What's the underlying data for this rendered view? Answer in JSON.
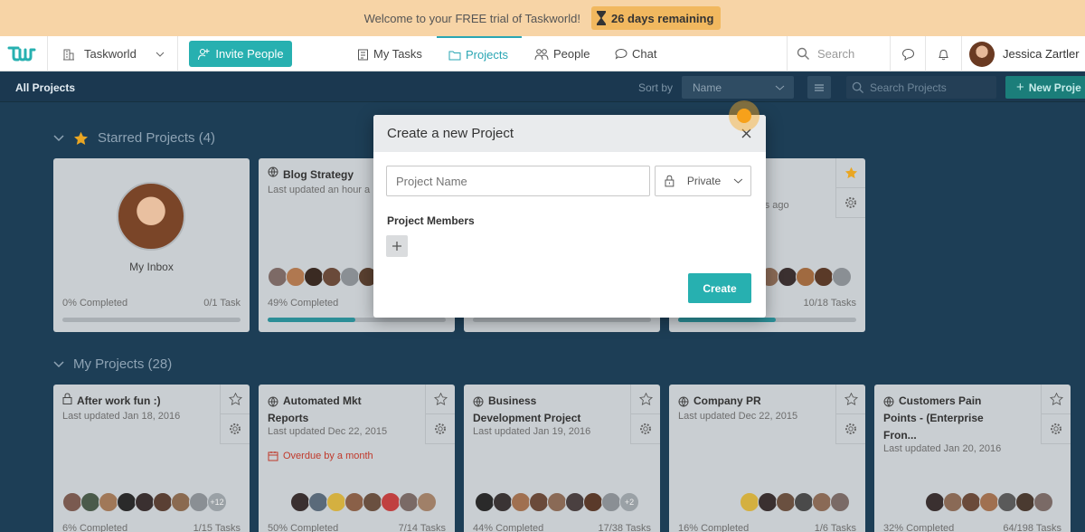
{
  "banner": {
    "message": "Welcome to your FREE trial of Taskworld!",
    "days_remaining": "26 days remaining"
  },
  "topnav": {
    "workspace": "Taskworld",
    "invite_label": "Invite People",
    "items": [
      {
        "label": "My Tasks",
        "icon": "clipboard-icon"
      },
      {
        "label": "Projects",
        "icon": "folder-icon",
        "active": true
      },
      {
        "label": "People",
        "icon": "people-icon"
      },
      {
        "label": "Chat",
        "icon": "chat-icon"
      }
    ],
    "search_placeholder": "Search",
    "user_name": "Jessica Zartler"
  },
  "subbar": {
    "title": "All Projects",
    "sort_label": "Sort by",
    "sort_value": "Name",
    "search_placeholder": "Search Projects",
    "new_project_label": "New Proje"
  },
  "starred": {
    "title": "Starred Projects (4)",
    "inbox": {
      "name": "My Inbox",
      "completed": "0% Completed",
      "tasks": "0/1 Task",
      "progress": 0
    },
    "blog": {
      "title": "Blog Strategy",
      "updated": "Last updated an hour a",
      "completed": "49% Completed",
      "progress": 49
    },
    "fourth": {
      "updated": "rs ago",
      "tasks": "10/18 Tasks",
      "progress": 55
    }
  },
  "my_projects": {
    "title": "My Projects (28)",
    "cards": [
      {
        "title_lines": [
          "After work fun :)"
        ],
        "updated": "Last updated Jan 18, 2016",
        "completed": "6% Completed",
        "tasks": "1/15 Tasks",
        "more": "+12",
        "privacy": "lock"
      },
      {
        "title_lines": [
          "Automated Mkt",
          "Reports"
        ],
        "updated": "Last updated Dec 22, 2015",
        "overdue": "Overdue by a month",
        "completed": "50% Completed",
        "tasks": "7/14 Tasks",
        "privacy": "globe"
      },
      {
        "title_lines": [
          "Business",
          "Development Project"
        ],
        "updated": "Last updated Jan 19, 2016",
        "completed": "44% Completed",
        "tasks": "17/38 Tasks",
        "more": "+2",
        "privacy": "globe"
      },
      {
        "title_lines": [
          "Company PR"
        ],
        "updated": "Last updated Dec 22, 2015",
        "completed": "16% Completed",
        "tasks": "1/6 Tasks",
        "privacy": "globe"
      },
      {
        "title_lines": [
          "Customers Pain",
          "Points - (Enterprise",
          "Fron..."
        ],
        "updated": "Last updated Jan 20, 2016",
        "completed": "32% Completed",
        "tasks": "64/198 Tasks",
        "privacy": "globe"
      }
    ]
  },
  "modal": {
    "title": "Create a new Project",
    "name_placeholder": "Project Name",
    "privacy_value": "Private",
    "members_label": "Project Members",
    "create_label": "Create"
  },
  "colors": {
    "accent": "#27b0b0",
    "background": "#1d3e56",
    "banner": "#f7d4a6"
  }
}
